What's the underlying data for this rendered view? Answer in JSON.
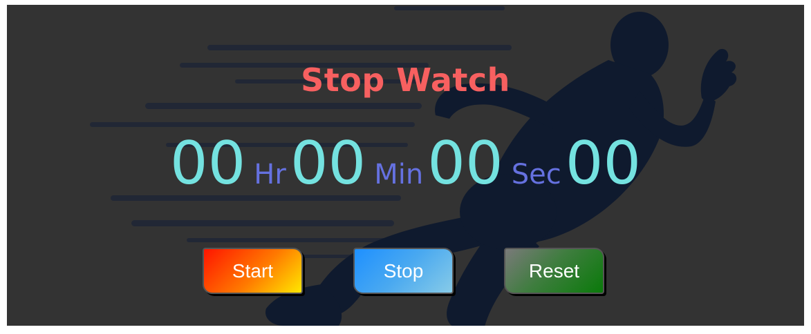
{
  "app": {
    "title": "Stop Watch"
  },
  "clock": {
    "hours": "00",
    "hours_unit": "Hr",
    "minutes": "00",
    "minutes_unit": "Min",
    "seconds": "00",
    "seconds_unit": "Sec",
    "centiseconds": "00"
  },
  "buttons": {
    "start_label": "Start",
    "stop_label": "Stop",
    "reset_label": "Reset"
  },
  "colors": {
    "title": "#f76060",
    "digits": "#74e2e0",
    "units": "#6571e0",
    "background": "#333333",
    "runner_silhouette": "#0f1a2e"
  },
  "background_image": {
    "icon": "running-man-silhouette"
  }
}
